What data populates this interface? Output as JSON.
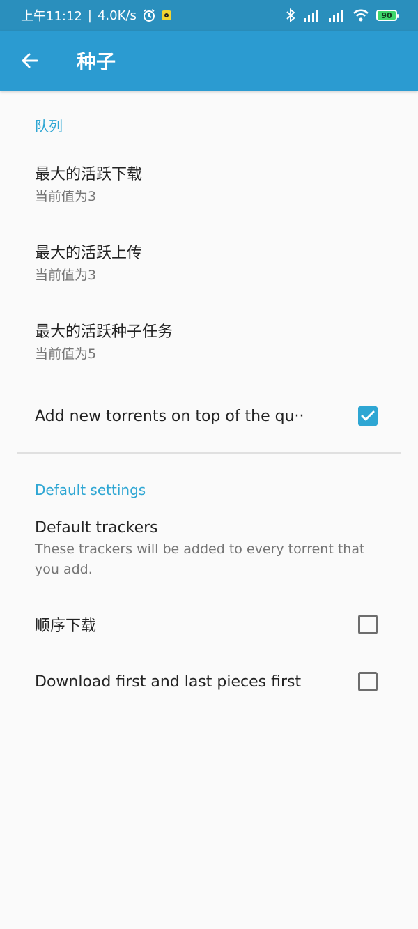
{
  "statusbar": {
    "time": "上午11:12",
    "separator": "|",
    "speed": "4.0K/s",
    "battery": "90"
  },
  "appbar": {
    "title": "种子"
  },
  "sections": {
    "queue": {
      "header": "队列",
      "max_downloads": {
        "title": "最大的活跃下载",
        "summary": "当前值为3"
      },
      "max_uploads": {
        "title": "最大的活跃上传",
        "summary": "当前值为3"
      },
      "max_torrents": {
        "title": "最大的活跃种子任务",
        "summary": "当前值为5"
      },
      "add_top": {
        "title": "Add new torrents on top of the qu··",
        "checked": true
      }
    },
    "defaults": {
      "header": "Default settings",
      "trackers": {
        "title": "Default trackers",
        "summary": "These trackers will be added to every torrent that you add."
      },
      "sequential": {
        "title": "顺序下载",
        "checked": false
      },
      "first_last": {
        "title": "Download first and last pieces first",
        "checked": false
      }
    }
  },
  "colors": {
    "statusbar": "#2a8fbd",
    "appbar": "#2b9bd1",
    "accent": "#2ea6d3"
  }
}
